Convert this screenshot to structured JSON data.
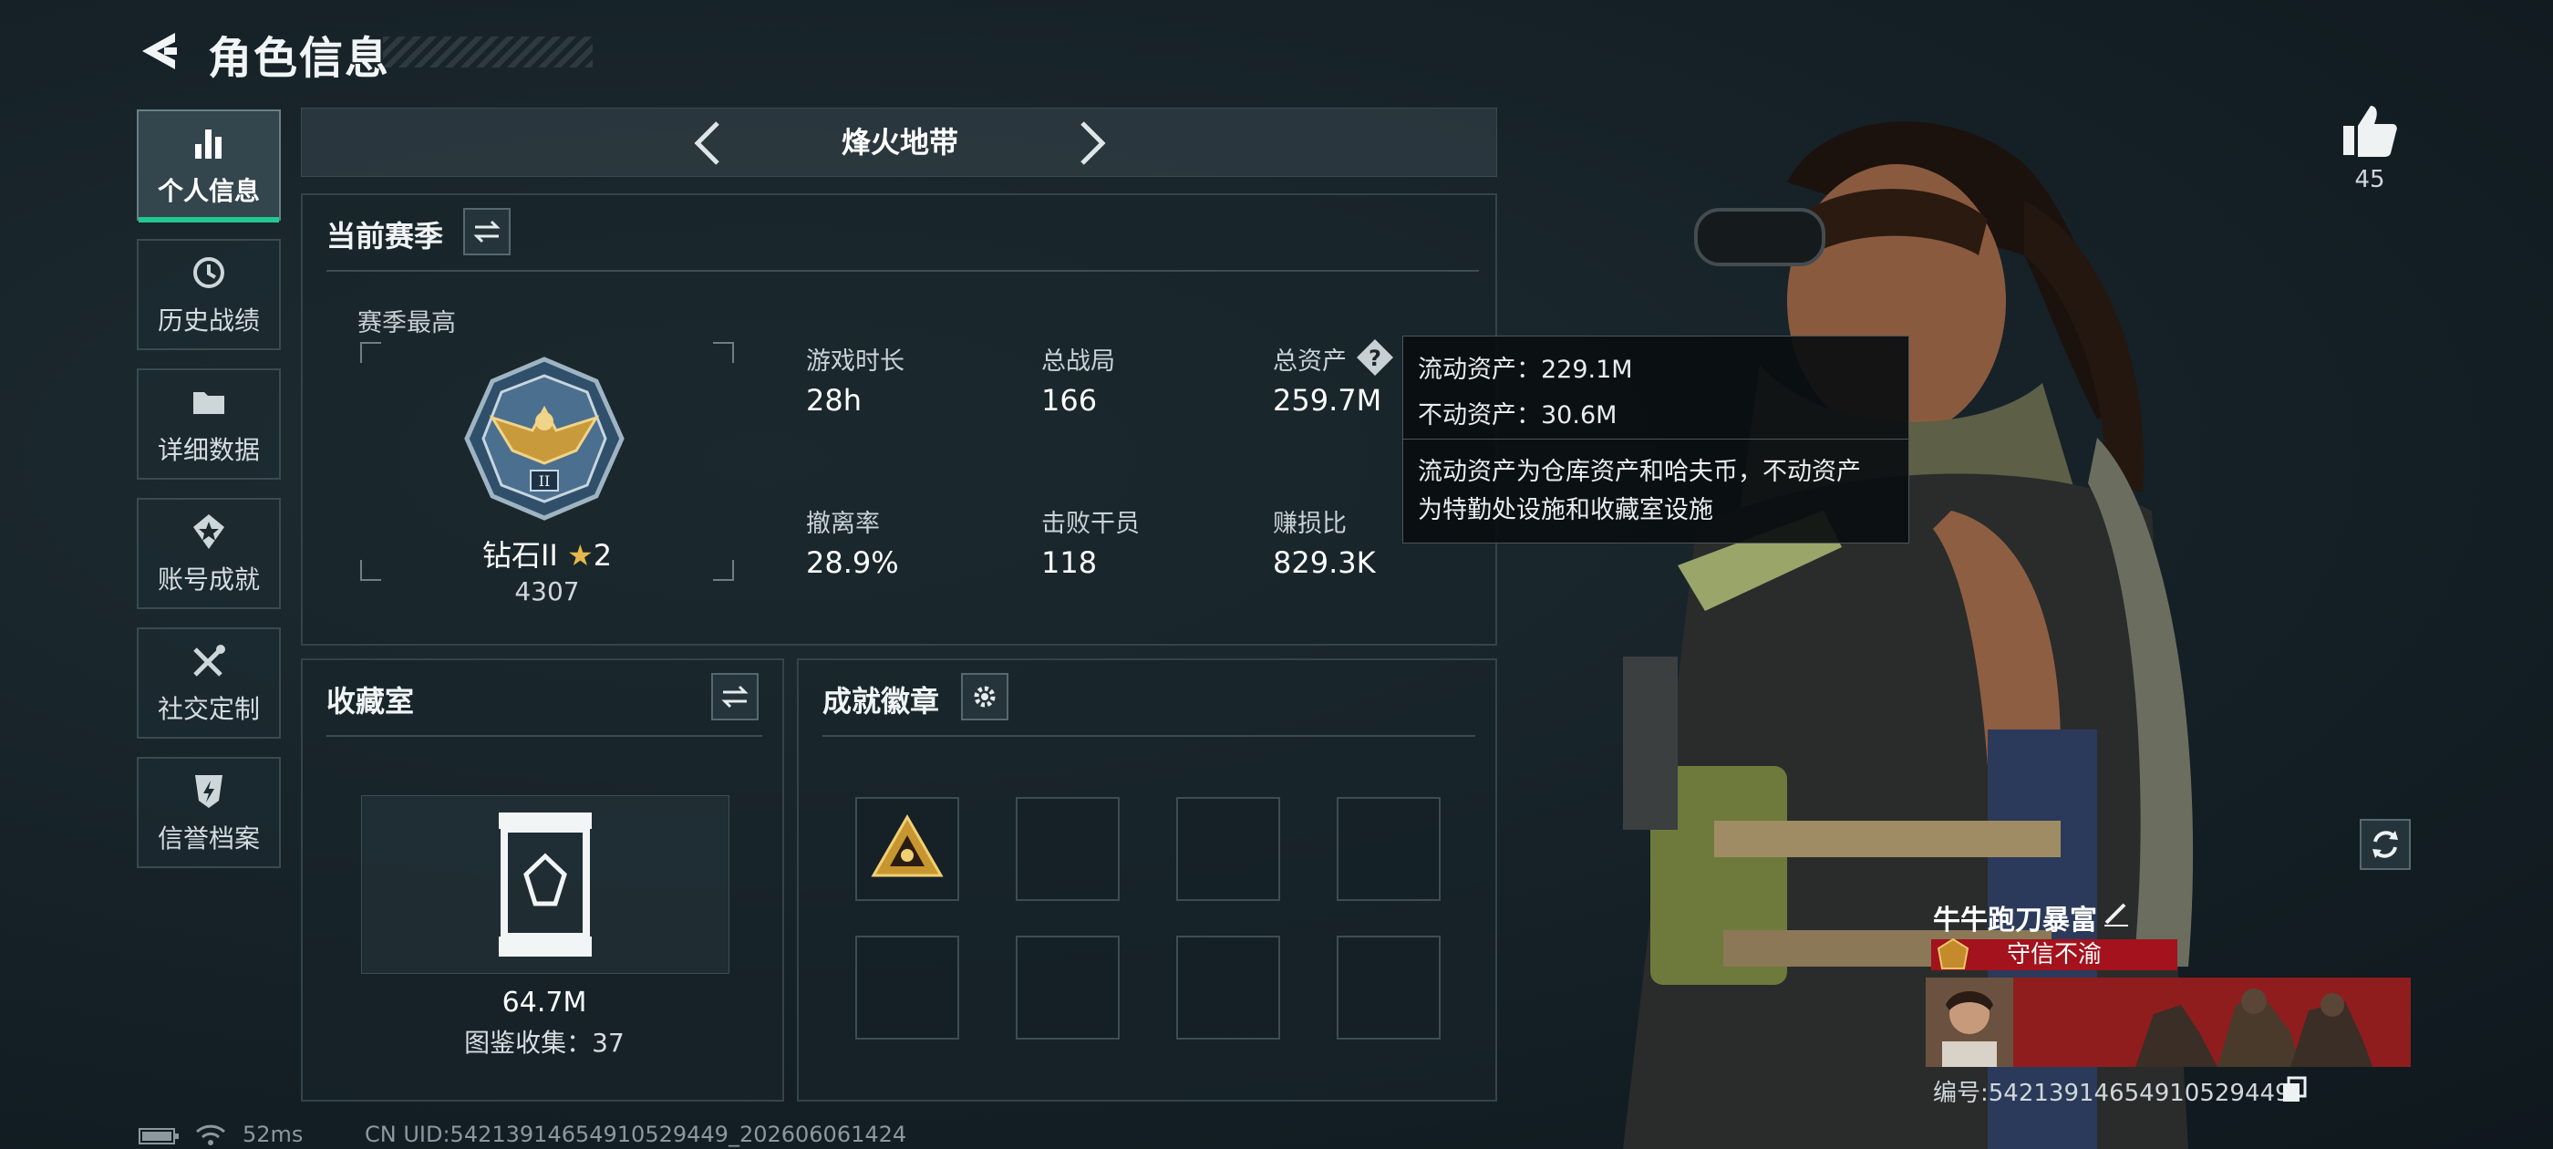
{
  "header": {
    "title": "角色信息"
  },
  "sidebar": {
    "items": [
      {
        "label": "个人信息",
        "icon": "bar-chart-icon",
        "active": true
      },
      {
        "label": "历史战绩",
        "icon": "history-clock-icon",
        "active": false
      },
      {
        "label": "详细数据",
        "icon": "folder-icon",
        "active": false
      },
      {
        "label": "账号成就",
        "icon": "badge-star-icon",
        "active": false
      },
      {
        "label": "社交定制",
        "icon": "tools-icon",
        "active": false
      },
      {
        "label": "信誉档案",
        "icon": "shield-bolt-icon",
        "active": false
      }
    ]
  },
  "mode": {
    "title": "烽火地带"
  },
  "season": {
    "title": "当前赛季",
    "highest_label": "赛季最高",
    "rank_name": "钻石II",
    "rank_stars": "2",
    "rank_score": "4307",
    "stats": [
      {
        "label": "游戏时长",
        "value": "28h"
      },
      {
        "label": "总战局",
        "value": "166"
      },
      {
        "label": "总资产",
        "value": "259.7M"
      },
      {
        "label": "撤离率",
        "value": "28.9%"
      },
      {
        "label": "击败干员",
        "value": "118"
      },
      {
        "label": "赚损比",
        "value": "829.3K"
      }
    ]
  },
  "tooltip": {
    "line1": "流动资产：229.1M",
    "line2": "不动资产：30.6M",
    "desc1": "流动资产为仓库资产和哈夫币，不动资产",
    "desc2": "为特勤处设施和收藏室设施"
  },
  "collection": {
    "title": "收藏室",
    "value": "64.7M",
    "count_text": "图鉴收集：37"
  },
  "achievements": {
    "title": "成就徽章"
  },
  "profile": {
    "likes": "45",
    "name": "牛牛跑刀暴富",
    "reputation": "守信不渝",
    "id_text": "编号:5421391465491052944​9"
  },
  "status": {
    "ping": "52ms",
    "uid": "CN UID:5421391465491052944​9_202606061424"
  },
  "colors": {
    "accent": "#20c98f",
    "reputation_bg": "#a3121d"
  }
}
